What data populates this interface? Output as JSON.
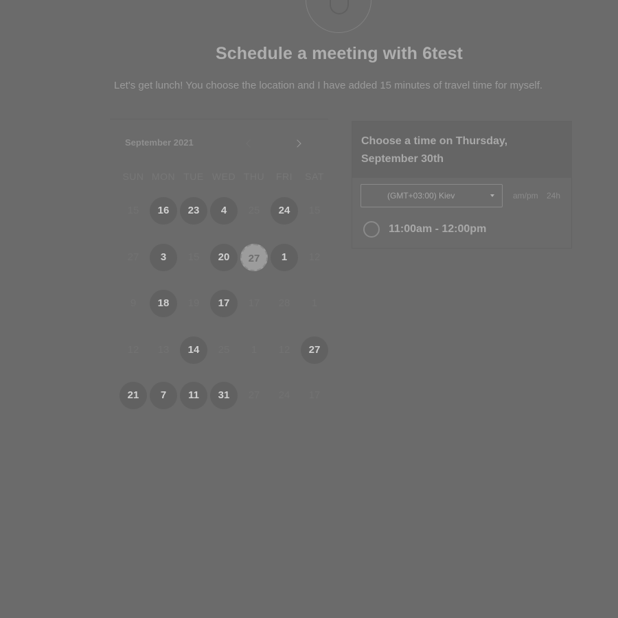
{
  "header": {
    "title": "Schedule a meeting with 6test",
    "subtitle": "Let's get lunch! You choose the location and I have added 15 minutes of travel time for myself."
  },
  "calendar": {
    "month_label": "September 2021",
    "weekdays": [
      "SUN",
      "MON",
      "TUE",
      "WED",
      "THU",
      "FRI",
      "SAT"
    ],
    "rows": [
      [
        {
          "label": "15",
          "state": "unavailable"
        },
        {
          "label": "16",
          "state": "available"
        },
        {
          "label": "23",
          "state": "available"
        },
        {
          "label": "4",
          "state": "available"
        },
        {
          "label": "25",
          "state": "unavailable"
        },
        {
          "label": "24",
          "state": "available"
        },
        {
          "label": "15",
          "state": "unavailable"
        }
      ],
      [
        {
          "label": "27",
          "state": "unavailable"
        },
        {
          "label": "3",
          "state": "available"
        },
        {
          "label": "15",
          "state": "unavailable"
        },
        {
          "label": "20",
          "state": "available"
        },
        {
          "label": "27",
          "state": "selected"
        },
        {
          "label": "1",
          "state": "available"
        },
        {
          "label": "12",
          "state": "unavailable"
        }
      ],
      [
        {
          "label": "9",
          "state": "unavailable"
        },
        {
          "label": "18",
          "state": "available"
        },
        {
          "label": "19",
          "state": "unavailable"
        },
        {
          "label": "17",
          "state": "available"
        },
        {
          "label": "17",
          "state": "unavailable"
        },
        {
          "label": "28",
          "state": "unavailable"
        },
        {
          "label": "1",
          "state": "unavailable"
        }
      ],
      [
        {
          "label": "12",
          "state": "unavailable"
        },
        {
          "label": "13",
          "state": "unavailable"
        },
        {
          "label": "14",
          "state": "available"
        },
        {
          "label": "25",
          "state": "unavailable"
        },
        {
          "label": "1",
          "state": "unavailable"
        },
        {
          "label": "12",
          "state": "unavailable"
        },
        {
          "label": "27",
          "state": "available"
        }
      ],
      [
        {
          "label": "21",
          "state": "available"
        },
        {
          "label": "7",
          "state": "available"
        },
        {
          "label": "11",
          "state": "available"
        },
        {
          "label": "31",
          "state": "available"
        },
        {
          "label": "27",
          "state": "unavailable"
        },
        {
          "label": "24",
          "state": "unavailable"
        },
        {
          "label": "17",
          "state": "unavailable"
        }
      ]
    ]
  },
  "times": {
    "heading": "Choose a time on Thursday, September 30th",
    "timezone": "(GMT+03:00) Kiev",
    "format_ampm": "am/pm",
    "format_24h": "24h",
    "slots": [
      "11:00am - 12:00pm"
    ]
  },
  "colors": {
    "overlay_background": "#6b6b6b",
    "available_day": "#616161",
    "selected_day": "#9c9c9c"
  },
  "icons": {
    "logo": "avatar-logo",
    "prev": "chevron-left-icon",
    "next": "chevron-right-icon",
    "tz_caret": "caret-down-icon",
    "slot_radio": "radio-icon"
  }
}
